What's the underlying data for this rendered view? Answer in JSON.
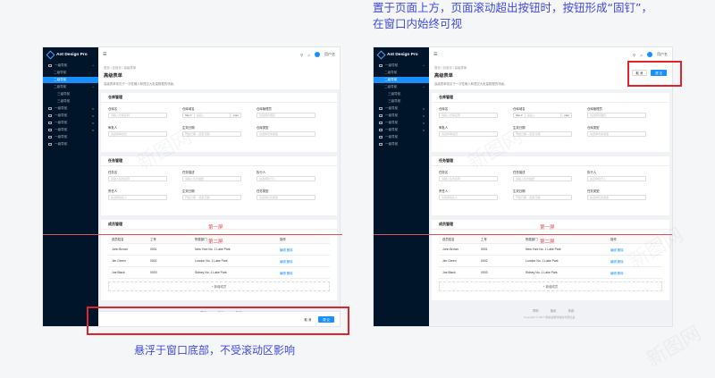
{
  "captions": {
    "top_line1": "置于页面上方，页面滚动超出按钮时，按钮形成“固钉”，",
    "top_line2": "在窗口内始终可视",
    "bottom": "悬浮于窗口底部，不受滚动区影响"
  },
  "app": {
    "logo_text": "Ant Design Pro",
    "user_name": "用户名",
    "menu": [
      {
        "label": "一级导航",
        "level": 0,
        "active": false,
        "chevron": "^"
      },
      {
        "label": "二级导航",
        "level": 1,
        "active": false
      },
      {
        "label": "二级导航",
        "level": 1,
        "active": true
      },
      {
        "label": "二级导航",
        "level": 1,
        "active": false,
        "chevron": "^"
      },
      {
        "label": "三级导航",
        "level": 2,
        "active": false
      },
      {
        "label": "三级导航",
        "level": 2,
        "active": false
      },
      {
        "label": "一级导航",
        "level": 0,
        "active": false,
        "chevron": "v"
      },
      {
        "label": "一级导航",
        "level": 0,
        "active": false,
        "chevron": "v"
      },
      {
        "label": "一级导航",
        "level": 0,
        "active": false,
        "chevron": "v"
      },
      {
        "label": "一级导航",
        "level": 0,
        "active": false,
        "chevron": "v"
      },
      {
        "label": "一级导航",
        "level": 0,
        "active": false
      },
      {
        "label": "一级导航",
        "level": 0,
        "active": false
      }
    ],
    "breadcrumb": "首页  /  应用页  /  高级表单",
    "page_title": "高级表单",
    "page_desc": "高级表单常见于一次性输入和提交大批量数据的场景。",
    "card1": {
      "title": "仓库管理",
      "fields": [
        {
          "label": "仓库名",
          "placeholder": "请输入仓库名称"
        },
        {
          "label": "仓库域名",
          "prefix": "http://",
          "placeholder": "请输入",
          "suffix": ".com"
        },
        {
          "label": "仓库管理员",
          "placeholder": "请选择管理员"
        },
        {
          "label": "审批人",
          "placeholder": "请选择审批员"
        },
        {
          "label": "生效日期",
          "placeholder": "开始日期 ~ 结束日期"
        },
        {
          "label": "仓库类型",
          "placeholder": "请选择仓库类型"
        }
      ]
    },
    "card2": {
      "title": "任务管理",
      "fields": [
        {
          "label": "任务名",
          "placeholder": "请输入任务名称"
        },
        {
          "label": "任务描述",
          "placeholder": "请输入任务描述"
        },
        {
          "label": "执行人",
          "placeholder": "请选择执行人"
        },
        {
          "label": "责任人",
          "placeholder": "请选择责任人"
        },
        {
          "label": "生效日期",
          "placeholder": "开始日期 ~ 结束日期"
        },
        {
          "label": "任务类型",
          "placeholder": "请选择任务类型"
        }
      ]
    },
    "card3": {
      "title": "成员管理",
      "columns": [
        "成员姓名",
        "工号",
        "所属部门",
        "操作"
      ],
      "rows": [
        {
          "name": "John Brown",
          "id": "0001",
          "dept": "New York No. 1 Lake Park",
          "action": "编辑  删除"
        },
        {
          "name": "Jim Green",
          "id": "0002",
          "dept": "London No. 1 Lake Park",
          "action": "编辑  删除"
        },
        {
          "name": "Joe Black",
          "id": "0003",
          "dept": "Sidney No. 1 Lake Park",
          "action": "编辑  删除"
        }
      ],
      "add_label": "+ 新增成员"
    },
    "fold_first": "第一屏",
    "fold_second": "第二屏",
    "footer_links": [
      "帮助",
      "隐私",
      "条款"
    ],
    "copyright": "Copyright © 2017 蚂蚁金服体验技术部出品",
    "cancel_label": "取 消",
    "submit_label": "提 交"
  },
  "watermark": "新图网"
}
